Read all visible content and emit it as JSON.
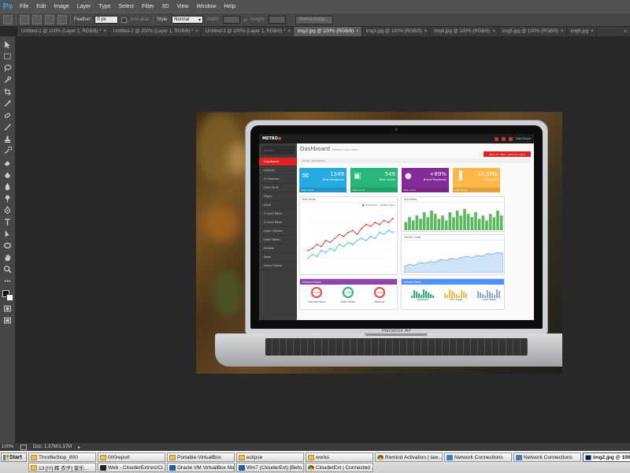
{
  "app": {
    "logo_text": "Ps",
    "accent": "#3fa9f5"
  },
  "menu": [
    "File",
    "Edit",
    "Image",
    "Layer",
    "Type",
    "Select",
    "Filter",
    "3D",
    "View",
    "Window",
    "Help"
  ],
  "options": {
    "feather_label": "Feather:",
    "feather_value": "0 px",
    "antialias_label": "Anti-alias",
    "style_label": "Style:",
    "style_value": "Normal",
    "width_label": "Width:",
    "height_label": "Height:",
    "refine_label": "Refine Edge..."
  },
  "tabs": [
    {
      "label": "Untitled-1 @ 100% (Layer 1, RGB/8) *",
      "active": false
    },
    {
      "label": "Untitled-2 @ 200% (Layer 1, RGB/8) *",
      "active": false
    },
    {
      "label": "Untitled-3 @ 200% (Layer 1, RGB/8) *",
      "active": false
    },
    {
      "label": "img2.jpg @ 100% (RGB/8)",
      "active": true
    },
    {
      "label": "img3.jpg @ 100% (RGB/8)",
      "active": false
    },
    {
      "label": "img4.jpg @ 100% (RGB/8)",
      "active": false
    },
    {
      "label": "img5.jpg @ 100% (RGB/8)",
      "active": false
    },
    {
      "label": "img6.jpg",
      "active": false
    }
  ],
  "tabs_overflow": "»",
  "tools": [
    "move-tool",
    "marquee-tool",
    "lasso-tool",
    "quick-select-tool",
    "crop-tool",
    "eyedropper-tool",
    "spot-heal-tool",
    "brush-tool",
    "clone-stamp-tool",
    "history-brush-tool",
    "eraser-tool",
    "gradient-tool",
    "blur-tool",
    "dodge-tool",
    "pen-tool",
    "type-tool",
    "path-select-tool",
    "shape-tool",
    "hand-tool",
    "zoom-tool"
  ],
  "status": {
    "zoom": "100%",
    "doc": "Doc: 1.37M/1.37M"
  },
  "image": {
    "brand": "MacBook Air",
    "dashboard": {
      "logo": "METRO",
      "title": "Dashboard",
      "subtitle": "statistics and more",
      "date_range": "April 13, 2013 - June 29, 2013",
      "breadcrumb": "Home  ›  Dashboard",
      "user": "Bob Nilson",
      "search_placeholder": "Search...",
      "side_items": [
        "Dashboard",
        "Layouts",
        "UI Features",
        "Form Stuff",
        "Pages",
        "Extra",
        "3 Level Menu",
        "4 Level Menu",
        "Login Options",
        "Data Tables",
        "Portlets",
        "Maps",
        "Visual Charts"
      ],
      "tiles": [
        {
          "value": "1349",
          "label": "New Feedbacks",
          "more": "View more",
          "color": "#27a9e3",
          "icon": "comments-icon"
        },
        {
          "value": "549",
          "label": "New Orders",
          "more": "View more",
          "color": "#28b779",
          "icon": "cart-icon"
        },
        {
          "value": "+89%",
          "label": "Brand Popularity",
          "more": "View more",
          "color": "#852b99",
          "icon": "globe-icon"
        },
        {
          "value": "12,5M$",
          "label": "Total Profit",
          "more": "View more",
          "color": "#ffb848",
          "icon": "bar-chart-icon"
        }
      ],
      "panels": {
        "site_visits": "Site Visits",
        "activities": "Activities",
        "server_load": "Server Load",
        "general_stats": "General Stats",
        "server_stats": "Server Stats",
        "site_legend": [
          "Unique Visits",
          "Page Views"
        ]
      },
      "stats": [
        {
          "value": "+12%",
          "label": "Transactions"
        },
        {
          "value": "+75%",
          "label": "New Visits"
        },
        {
          "value": "+46%",
          "label": "Bounce"
        }
      ],
      "server_stats": [
        "Network",
        "CPU Load",
        "Load Rate"
      ],
      "chart_series": {
        "visits": [
          4,
          6,
          5,
          8,
          7,
          9,
          8,
          11,
          10,
          12,
          11,
          13,
          14,
          13,
          15,
          14,
          17,
          16,
          18,
          17
        ],
        "views": [
          8,
          9,
          11,
          10,
          13,
          12,
          14,
          16,
          15,
          17,
          18,
          16,
          19,
          21,
          20,
          22,
          21,
          23,
          22,
          24
        ],
        "activities": [
          5,
          8,
          6,
          9,
          7,
          11,
          8,
          12,
          10,
          7,
          9,
          6,
          11,
          8,
          12,
          9,
          13,
          10,
          8,
          11,
          7,
          9,
          6,
          10,
          8,
          12,
          9
        ]
      }
    }
  },
  "taskbar": {
    "start_label": "Start",
    "row1": [
      {
        "label": "ThrottleStop_600",
        "icon": "folder"
      },
      {
        "label": "000report",
        "icon": "folder"
      },
      {
        "label": "Portable-VirtualBox",
        "icon": "folder"
      },
      {
        "label": "eclipse",
        "icon": "folder"
      },
      {
        "label": "works",
        "icon": "folder"
      },
      {
        "label": "Remind Activation | taw...",
        "icon": "chrome"
      },
      {
        "label": "Network Connections",
        "icon": "net"
      },
      {
        "label": "Network Connections",
        "icon": "net"
      },
      {
        "label": "img2.jpg @ 100...",
        "icon": "psx",
        "active": true
      }
    ],
    "row2": [
      {
        "label": "13 [!!!] 辉 衣子] 奎乐...",
        "icon": "folder"
      },
      {
        "label": "Web - ClouderExt/src/Cl...",
        "icon": "dos"
      },
      {
        "label": "Oracle VM VirtualBox Ma...",
        "icon": "vbox"
      },
      {
        "label": "Win7 (ClouderExt) [Befo...",
        "icon": "vbox"
      },
      {
        "label": "ClouderExt | Connected ...",
        "icon": "chrome"
      }
    ]
  }
}
